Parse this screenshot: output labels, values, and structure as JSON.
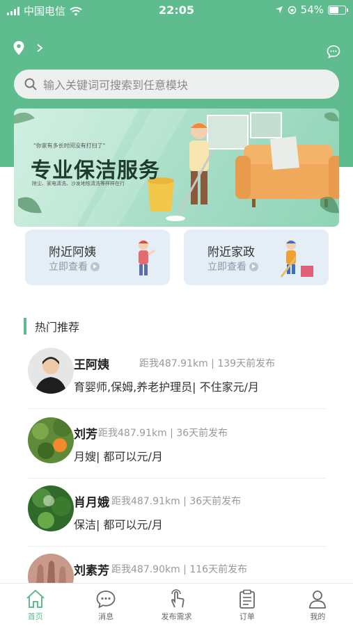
{
  "status_bar": {
    "carrier": "中国电信",
    "time": "22:05",
    "battery": "54%",
    "battery_level": 0.54
  },
  "search": {
    "placeholder": "输入关键词可搜索到任意模块"
  },
  "banner": {
    "small_text": "\"你家有多长时间没有打扫了\"",
    "title": "专业保洁服务",
    "description": "除尘、家电清洗、沙发地毯清洗等样样在行"
  },
  "quick_links": [
    {
      "title": "附近阿姨",
      "subtitle": "立即查看"
    },
    {
      "title": "附近家政",
      "subtitle": "立即查看"
    }
  ],
  "section": {
    "title": "热门推荐"
  },
  "recommendations": [
    {
      "name": "王阿姨",
      "distance": "距我487.91km",
      "posted": "139天前发布",
      "description": "育婴师,保姆,养老护理员| 不住家元/月"
    },
    {
      "name": "刘芳",
      "distance": "距我487.91km",
      "posted": "36天前发布",
      "description": "月嫂| 都可以元/月"
    },
    {
      "name": "肖月娥",
      "distance": "距我487.91km",
      "posted": "36天前发布",
      "description": "保洁| 都可以元/月"
    },
    {
      "name": "刘素芳",
      "distance": "距我487.90km",
      "posted": "116天前发布",
      "description": ""
    }
  ],
  "tabs": [
    {
      "label": "首页",
      "icon": "home-icon",
      "active": true
    },
    {
      "label": "消息",
      "icon": "message-icon",
      "active": false
    },
    {
      "label": "发布需求",
      "icon": "publish-icon",
      "active": false
    },
    {
      "label": "订单",
      "icon": "order-icon",
      "active": false
    },
    {
      "label": "我的",
      "icon": "profile-icon",
      "active": false
    }
  ],
  "colors": {
    "accent": "#5ebc8f",
    "inactive_tab": "#666666"
  }
}
